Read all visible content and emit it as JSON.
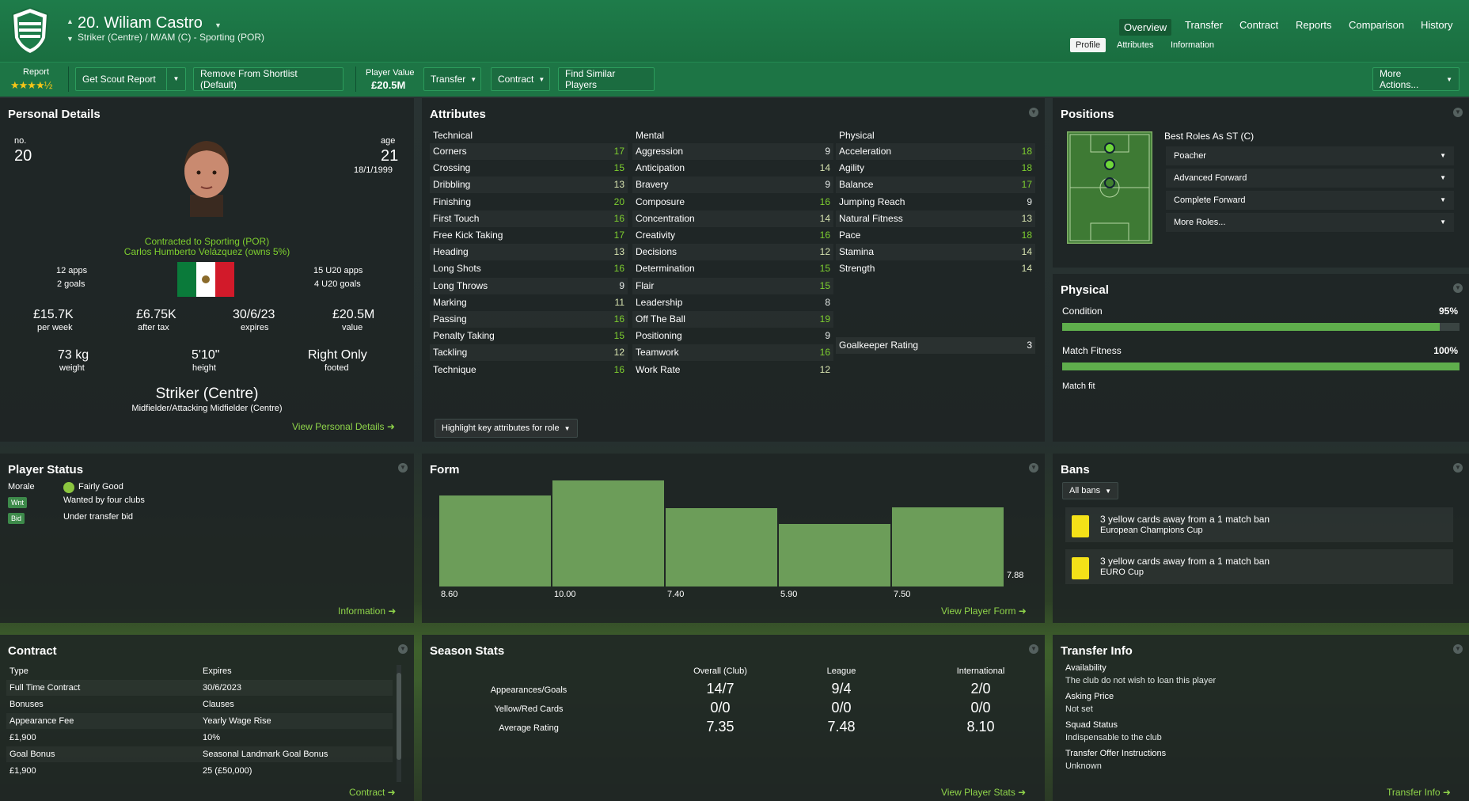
{
  "header": {
    "title": "20. Wiliam Castro",
    "subtitle": "Striker (Centre) / M/AM (C) - Sporting (POR)",
    "nav": [
      "Overview",
      "Transfer",
      "Contract",
      "Reports",
      "Comparison",
      "History"
    ],
    "subnav": [
      "Profile",
      "Attributes",
      "Information"
    ]
  },
  "toolbar": {
    "report_label": "Report",
    "report_stars": "★★★★½",
    "scout": "Get Scout Report",
    "shortlist": "Remove From Shortlist (Default)",
    "pv_label": "Player Value",
    "pv": "£20.5M",
    "transfer": "Transfer",
    "contract": "Contract",
    "similar": "Find Similar Players",
    "more": "More Actions..."
  },
  "personal": {
    "title": "Personal Details",
    "no_label": "no.",
    "no": "20",
    "age_label": "age",
    "age": "21",
    "dob": "18/1/1999",
    "contract1": "Contracted to Sporting (POR)",
    "contract2": "Carlos Humberto Velázquez (owns 5%)",
    "apps": "12 apps",
    "goals": "2 goals",
    "u20apps": "15 U20 apps",
    "u20goals": "4 U20 goals",
    "wage": "£15.7K",
    "wage_l": "per week",
    "tax": "£6.75K",
    "tax_l": "after tax",
    "exp": "30/6/23",
    "exp_l": "expires",
    "val": "£20.5M",
    "val_l": "value",
    "weight": "73 kg",
    "weight_l": "weight",
    "height": "5'10\"",
    "height_l": "height",
    "foot": "Right Only",
    "foot_l": "footed",
    "pos": "Striker (Centre)",
    "pos2": "Midfielder/Attacking Midfielder (Centre)",
    "link": "View Personal Details ➜"
  },
  "attributes": {
    "title": "Attributes",
    "tech_h": "Technical",
    "mental_h": "Mental",
    "phys_h": "Physical",
    "technical": [
      [
        "Corners",
        "17"
      ],
      [
        "Crossing",
        "15"
      ],
      [
        "Dribbling",
        "13"
      ],
      [
        "Finishing",
        "20"
      ],
      [
        "First Touch",
        "16"
      ],
      [
        "Free Kick Taking",
        "17"
      ],
      [
        "Heading",
        "13"
      ],
      [
        "Long Shots",
        "16"
      ],
      [
        "Long Throws",
        "9"
      ],
      [
        "Marking",
        "11"
      ],
      [
        "Passing",
        "16"
      ],
      [
        "Penalty Taking",
        "15"
      ],
      [
        "Tackling",
        "12"
      ],
      [
        "Technique",
        "16"
      ]
    ],
    "mental": [
      [
        "Aggression",
        "9"
      ],
      [
        "Anticipation",
        "14"
      ],
      [
        "Bravery",
        "9"
      ],
      [
        "Composure",
        "16"
      ],
      [
        "Concentration",
        "14"
      ],
      [
        "Creativity",
        "16"
      ],
      [
        "Decisions",
        "12"
      ],
      [
        "Determination",
        "15"
      ],
      [
        "Flair",
        "15"
      ],
      [
        "Leadership",
        "8"
      ],
      [
        "Off The Ball",
        "19"
      ],
      [
        "Positioning",
        "9"
      ],
      [
        "Teamwork",
        "16"
      ],
      [
        "Work Rate",
        "12"
      ]
    ],
    "physical": [
      [
        "Acceleration",
        "18"
      ],
      [
        "Agility",
        "18"
      ],
      [
        "Balance",
        "17"
      ],
      [
        "Jumping Reach",
        "9"
      ],
      [
        "Natural Fitness",
        "13"
      ],
      [
        "Pace",
        "18"
      ],
      [
        "Stamina",
        "14"
      ],
      [
        "Strength",
        "14"
      ]
    ],
    "gk_label": "Goalkeeper Rating",
    "gk": "3",
    "highlight": "Highlight key attributes for role"
  },
  "positions": {
    "title": "Positions",
    "best": "Best Roles As ST (C)",
    "roles": [
      "Poacher",
      "Advanced Forward",
      "Complete Forward",
      "More Roles..."
    ]
  },
  "physical": {
    "title": "Physical",
    "cond_l": "Condition",
    "cond": "95%",
    "cond_v": 0.95,
    "mf_l": "Match Fitness",
    "mf": "100%",
    "mf_v": 1.0,
    "matchfit": "Match fit"
  },
  "status": {
    "title": "Player Status",
    "morale_l": "Morale",
    "morale": "Fairly Good",
    "wnt": "Wnt",
    "wnt_t": "Wanted by four clubs",
    "bid": "Bid",
    "bid_t": "Under transfer bid",
    "link": "Information ➜"
  },
  "chart_data": {
    "type": "bar",
    "values": [
      8.6,
      10.0,
      7.4,
      5.9,
      7.5,
      7.88
    ],
    "labels": [
      "8.60",
      "10.00",
      "7.40",
      "5.90",
      "7.50",
      "7.88"
    ],
    "title": "Form"
  },
  "form": {
    "link": "View Player Form ➜"
  },
  "bans": {
    "title": "Bans",
    "filter": "All bans",
    "items": [
      [
        "3 yellow cards away from a 1 match ban",
        "European Champions Cup"
      ],
      [
        "3 yellow cards away from a 1 match ban",
        "EURO Cup"
      ]
    ]
  },
  "contract": {
    "title": "Contract",
    "rows": [
      [
        "Type",
        "Expires"
      ],
      [
        "Full Time Contract",
        "30/6/2023"
      ],
      [
        "Bonuses",
        "Clauses"
      ],
      [
        "Appearance Fee",
        "Yearly Wage Rise"
      ],
      [
        "£1,900",
        "10%"
      ],
      [
        "Goal Bonus",
        "Seasonal Landmark Goal Bonus"
      ],
      [
        "£1,900",
        "25 (£50,000)"
      ]
    ],
    "link": "Contract ➜"
  },
  "season": {
    "title": "Season Stats",
    "cols": [
      "Overall (Club)",
      "League",
      "International"
    ],
    "rows": [
      [
        "Appearances/Goals",
        "14/7",
        "9/4",
        "2/0"
      ],
      [
        "Yellow/Red Cards",
        "0/0",
        "0/0",
        "0/0"
      ],
      [
        "Average Rating",
        "7.35",
        "7.48",
        "8.10"
      ]
    ],
    "link": "View Player Stats ➜"
  },
  "transfer": {
    "title": "Transfer Info",
    "rows": [
      [
        "Availability",
        "The club do not wish to loan this player"
      ],
      [
        "Asking Price",
        "Not set"
      ],
      [
        "Squad Status",
        "Indispensable to the club"
      ],
      [
        "Transfer Offer Instructions",
        "Unknown"
      ]
    ],
    "link": "Transfer Info ➜"
  }
}
